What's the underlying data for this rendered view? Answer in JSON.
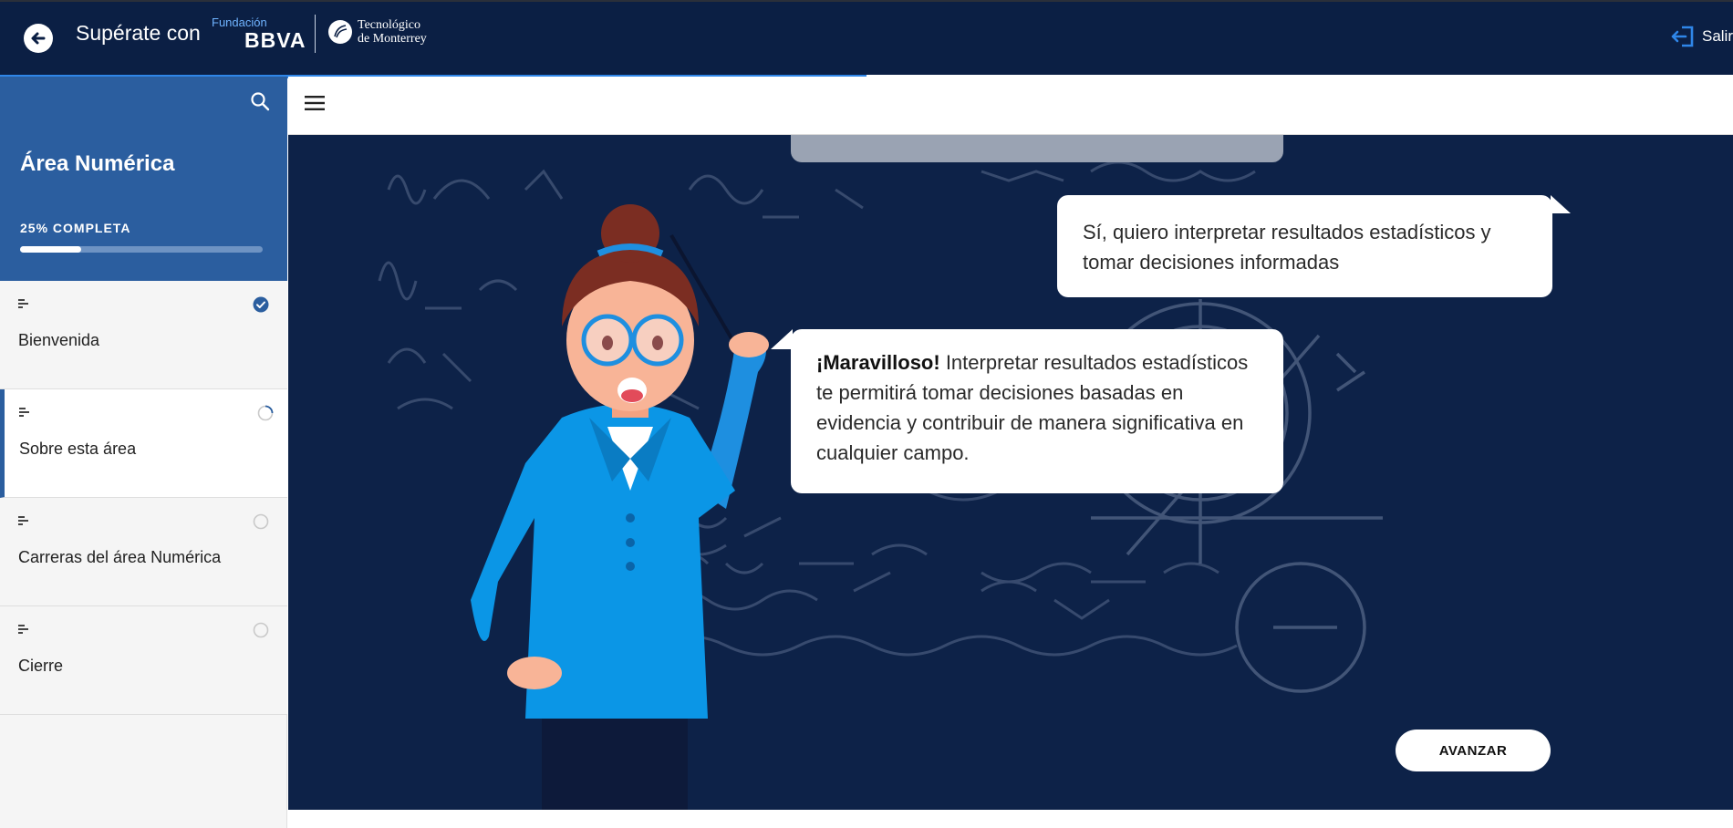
{
  "header": {
    "title": "Supérate con",
    "partner_small": "Fundación",
    "partner_logo": "BBVA",
    "partner2_line1": "Tecnológico",
    "partner2_line2": "de Monterrey",
    "exit_label": "Salir",
    "back_icon": "arrow-left-icon",
    "exit_icon": "exit-icon",
    "course_progress_percent": 50
  },
  "sidebar": {
    "area_title": "Área Numérica",
    "progress_label": "25% COMPLETA",
    "progress_percent": 25,
    "items": [
      {
        "label": "Bienvenida",
        "status": "completed",
        "icon": "lesson-lines-icon"
      },
      {
        "label": "Sobre esta área",
        "status": "in-progress",
        "icon": "lesson-lines-icon"
      },
      {
        "label": "Carreras del área Numérica",
        "status": "not-started",
        "icon": "lesson-lines-icon"
      },
      {
        "label": "Cierre",
        "status": "not-started",
        "icon": "lesson-lines-icon"
      }
    ]
  },
  "content": {
    "menu_icon": "hamburger-icon",
    "user_reply": "Sí, quiero interpretar resultados estadísticos y tomar decisiones informadas",
    "mentor_bold": "¡Maravilloso!",
    "mentor_text": " Interpretar resultados estadísticos te permitirá tomar decisiones basadas en evidencia y contribuir de manera significativa en cualquier campo.",
    "advance_label": "AVANZAR"
  },
  "colors": {
    "header_bg": "#0b1f44",
    "sidebar_header_bg": "#2b5e9f",
    "accent": "#2f86e8",
    "stage_bg": "#0d2248"
  }
}
